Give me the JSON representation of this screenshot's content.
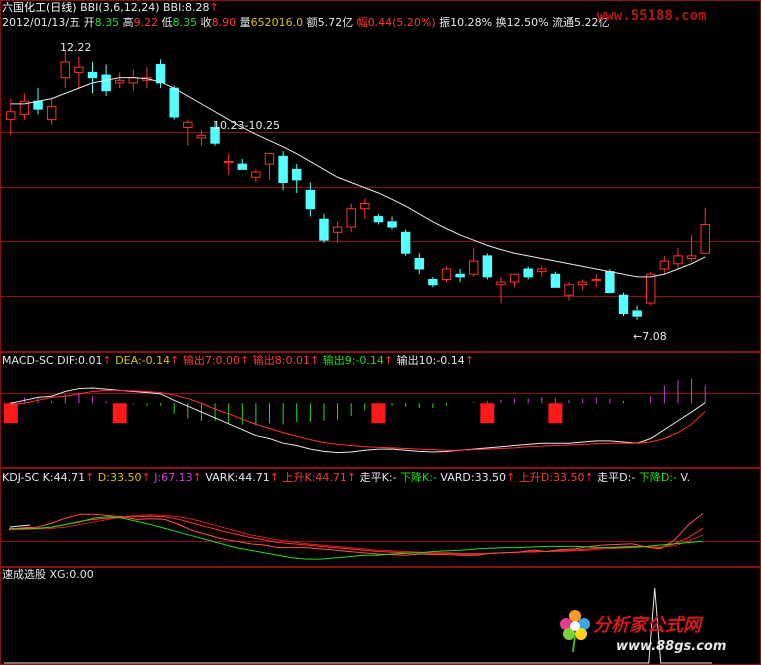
{
  "header": {
    "line1": [
      {
        "text": "六国化工(日线)",
        "color": "#ffffff"
      },
      {
        "text": " BBI(3,6,12,24) ",
        "color": "#e8e8e8"
      },
      {
        "text": "BBI:8.28",
        "color": "#e8e8e8"
      },
      {
        "text": "↑",
        "color": "#ff3030"
      }
    ],
    "line2": [
      {
        "text": "2012/01/13/五 ",
        "color": "#e8e8e8"
      },
      {
        "text": "开",
        "color": "#e8e8e8"
      },
      {
        "text": "8.35 ",
        "color": "#22dd22"
      },
      {
        "text": "高",
        "color": "#e8e8e8"
      },
      {
        "text": "9.22 ",
        "color": "#ff3838"
      },
      {
        "text": "低",
        "color": "#e8e8e8"
      },
      {
        "text": "8.35 ",
        "color": "#22dd22"
      },
      {
        "text": "收",
        "color": "#e8e8e8"
      },
      {
        "text": "8.90 ",
        "color": "#ff3838"
      },
      {
        "text": "量",
        "color": "#e8e8e8"
      },
      {
        "text": "652016.0 ",
        "color": "#e0c000"
      },
      {
        "text": "额",
        "color": "#e8e8e8"
      },
      {
        "text": "5.72亿 ",
        "color": "#e8e8e8"
      },
      {
        "text": "幅",
        "color": "#ff3838"
      },
      {
        "text": "0.44(5.20%) ",
        "color": "#ff3838"
      },
      {
        "text": "振",
        "color": "#e8e8e8"
      },
      {
        "text": "10.28% ",
        "color": "#e8e8e8"
      },
      {
        "text": "换",
        "color": "#e8e8e8"
      },
      {
        "text": "12.50% ",
        "color": "#e8e8e8"
      },
      {
        "text": "流通",
        "color": "#e8e8e8"
      },
      {
        "text": "5.22亿",
        "color": "#e8e8e8"
      }
    ]
  },
  "watermark_top": "www.55188.com",
  "watermark_bottom": {
    "title": "分析家公式网",
    "url": "www.88gs.com"
  },
  "annotations": {
    "high_label": "12.22",
    "low_label": "←7.08",
    "mid_label": "10.23-10.25"
  },
  "macd_header": [
    {
      "text": "MACD-SC ",
      "color": "#e8e8e8"
    },
    {
      "text": "DIF:0.01",
      "color": "#e8e8e8"
    },
    {
      "text": "↑",
      "color": "#ff3030"
    },
    {
      "text": "  DEA:-0.14",
      "color": "#e0c000"
    },
    {
      "text": "↑",
      "color": "#ff3030"
    },
    {
      "text": "       输出7:0.00",
      "color": "#ff3838"
    },
    {
      "text": "↑",
      "color": "#ff3030"
    },
    {
      "text": "  输出8:0.01",
      "color": "#ff3838"
    },
    {
      "text": "↑",
      "color": "#ff3030"
    },
    {
      "text": "  输出9:-0.14",
      "color": "#22dd22"
    },
    {
      "text": "↑",
      "color": "#ff3030"
    },
    {
      "text": "  输出10:-0.14",
      "color": "#e8e8e8"
    },
    {
      "text": "↑",
      "color": "#ff3030"
    }
  ],
  "kdj_header": [
    {
      "text": "KDJ-SC ",
      "color": "#e8e8e8"
    },
    {
      "text": "K:44.71",
      "color": "#e8e8e8"
    },
    {
      "text": "↑",
      "color": "#ff3030"
    },
    {
      "text": "  D:33.50",
      "color": "#e0c000"
    },
    {
      "text": "↑",
      "color": "#ff3030"
    },
    {
      "text": "  J:67.13",
      "color": "#d040e0"
    },
    {
      "text": "↑",
      "color": "#ff3030"
    },
    {
      "text": "  VARK:44.71",
      "color": "#e8e8e8"
    },
    {
      "text": "↑",
      "color": "#ff3030"
    },
    {
      "text": "  上升K:44.71",
      "color": "#ff3838"
    },
    {
      "text": "↑",
      "color": "#ff3030"
    },
    {
      "text": "  走平K:-",
      "color": "#e8e8e8"
    },
    {
      "text": "  下降K:-",
      "color": "#22dd22"
    },
    {
      "text": "  VARD:33.50",
      "color": "#e8e8e8"
    },
    {
      "text": "↑",
      "color": "#ff3030"
    },
    {
      "text": "  上升D:33.50",
      "color": "#ff3838"
    },
    {
      "text": "↑",
      "color": "#ff3030"
    },
    {
      "text": "  走平D:-",
      "color": "#e8e8e8"
    },
    {
      "text": "  下降D:-",
      "color": "#22dd22"
    },
    {
      "text": "  V.",
      "color": "#e8e8e8"
    }
  ],
  "xg_header": [
    {
      "text": "速成选股 ",
      "color": "#e8e8e8"
    },
    {
      "text": "XG:0.00",
      "color": "#e8e8e8"
    }
  ],
  "colors": {
    "up": "#ff3030",
    "down": "#54ffff",
    "bbi": "#e8e8e8",
    "grid": "#8b1010",
    "dif": "#e8e8e8",
    "dea": "#ff3030",
    "k": "#ff3030",
    "d": "#ff3030",
    "green": "#22dd22"
  },
  "chart_data": [
    {
      "type": "candlestick",
      "title": "六国化工(日线)",
      "ylim": [
        6.6,
        12.8
      ],
      "candles": [
        {
          "o": 10.9,
          "h": 11.3,
          "l": 10.6,
          "c": 11.05
        },
        {
          "o": 11.0,
          "h": 11.4,
          "l": 10.9,
          "c": 11.25
        },
        {
          "o": 11.25,
          "h": 11.5,
          "l": 11.0,
          "c": 11.1
        },
        {
          "o": 10.9,
          "h": 11.3,
          "l": 10.8,
          "c": 11.15
        },
        {
          "o": 11.7,
          "h": 12.22,
          "l": 11.5,
          "c": 12.0
        },
        {
          "o": 11.8,
          "h": 12.1,
          "l": 11.5,
          "c": 11.9
        },
        {
          "o": 11.8,
          "h": 12.0,
          "l": 11.4,
          "c": 11.7
        },
        {
          "o": 11.75,
          "h": 11.95,
          "l": 11.35,
          "c": 11.45
        },
        {
          "o": 11.6,
          "h": 11.8,
          "l": 11.5,
          "c": 11.65
        },
        {
          "o": 11.6,
          "h": 11.85,
          "l": 11.45,
          "c": 11.7
        },
        {
          "o": 11.65,
          "h": 11.9,
          "l": 11.5,
          "c": 11.7
        },
        {
          "o": 11.95,
          "h": 12.05,
          "l": 11.5,
          "c": 11.6
        },
        {
          "o": 11.5,
          "h": 11.55,
          "l": 10.9,
          "c": 10.95
        },
        {
          "o": 10.75,
          "h": 10.9,
          "l": 10.4,
          "c": 10.85
        },
        {
          "o": 10.55,
          "h": 10.7,
          "l": 10.4,
          "c": 10.6
        },
        {
          "o": 10.75,
          "h": 10.85,
          "l": 10.4,
          "c": 10.45
        },
        {
          "o": 10.1,
          "h": 10.25,
          "l": 9.85,
          "c": 10.1
        },
        {
          "o": 10.05,
          "h": 10.15,
          "l": 9.95,
          "c": 9.95
        },
        {
          "o": 9.8,
          "h": 9.95,
          "l": 9.7,
          "c": 9.9
        },
        {
          "o": 10.05,
          "h": 10.25,
          "l": 9.75,
          "c": 10.25
        },
        {
          "o": 10.2,
          "h": 10.3,
          "l": 9.55,
          "c": 9.7
        },
        {
          "o": 9.95,
          "h": 10.05,
          "l": 9.5,
          "c": 9.75
        },
        {
          "o": 9.55,
          "h": 9.7,
          "l": 9.05,
          "c": 9.2
        },
        {
          "o": 9.0,
          "h": 9.1,
          "l": 8.55,
          "c": 8.6
        },
        {
          "o": 8.75,
          "h": 8.95,
          "l": 8.55,
          "c": 8.85
        },
        {
          "o": 8.85,
          "h": 9.3,
          "l": 8.75,
          "c": 9.2
        },
        {
          "o": 9.2,
          "h": 9.4,
          "l": 9.0,
          "c": 9.3
        },
        {
          "o": 9.05,
          "h": 9.1,
          "l": 8.9,
          "c": 8.95
        },
        {
          "o": 8.95,
          "h": 9.05,
          "l": 8.8,
          "c": 8.85
        },
        {
          "o": 8.75,
          "h": 8.8,
          "l": 8.3,
          "c": 8.35
        },
        {
          "o": 8.25,
          "h": 8.35,
          "l": 7.95,
          "c": 8.05
        },
        {
          "o": 7.85,
          "h": 7.9,
          "l": 7.7,
          "c": 7.75
        },
        {
          "o": 7.85,
          "h": 8.1,
          "l": 7.8,
          "c": 8.05
        },
        {
          "o": 7.95,
          "h": 8.05,
          "l": 7.8,
          "c": 7.9
        },
        {
          "o": 7.95,
          "h": 8.45,
          "l": 7.9,
          "c": 8.2
        },
        {
          "o": 8.3,
          "h": 8.35,
          "l": 7.85,
          "c": 7.9
        },
        {
          "o": 7.75,
          "h": 7.9,
          "l": 7.4,
          "c": 7.8
        },
        {
          "o": 7.8,
          "h": 7.95,
          "l": 7.7,
          "c": 7.95
        },
        {
          "o": 8.05,
          "h": 8.1,
          "l": 7.85,
          "c": 7.9
        },
        {
          "o": 8.0,
          "h": 8.1,
          "l": 7.9,
          "c": 8.05
        },
        {
          "o": 7.95,
          "h": 8.0,
          "l": 7.7,
          "c": 7.7
        },
        {
          "o": 7.55,
          "h": 7.8,
          "l": 7.45,
          "c": 7.75
        },
        {
          "o": 7.75,
          "h": 7.85,
          "l": 7.65,
          "c": 7.8
        },
        {
          "o": 7.85,
          "h": 7.95,
          "l": 7.7,
          "c": 7.85
        },
        {
          "o": 8.0,
          "h": 8.05,
          "l": 7.6,
          "c": 7.6
        },
        {
          "o": 7.55,
          "h": 7.6,
          "l": 7.15,
          "c": 7.2
        },
        {
          "o": 7.25,
          "h": 7.35,
          "l": 7.08,
          "c": 7.15
        },
        {
          "o": 7.4,
          "h": 8.0,
          "l": 7.35,
          "c": 7.95
        },
        {
          "o": 8.05,
          "h": 8.3,
          "l": 7.95,
          "c": 8.2
        },
        {
          "o": 8.15,
          "h": 8.45,
          "l": 8.05,
          "c": 8.3
        },
        {
          "o": 8.25,
          "h": 8.7,
          "l": 8.2,
          "c": 8.3
        },
        {
          "o": 8.35,
          "h": 9.22,
          "l": 8.35,
          "c": 8.9
        }
      ],
      "bbi": [
        11.2,
        11.2,
        11.25,
        11.3,
        11.4,
        11.5,
        11.6,
        11.65,
        11.7,
        11.7,
        11.68,
        11.62,
        11.5,
        11.35,
        11.2,
        11.05,
        10.9,
        10.75,
        10.62,
        10.5,
        10.38,
        10.25,
        10.1,
        9.95,
        9.8,
        9.7,
        9.6,
        9.5,
        9.38,
        9.25,
        9.1,
        8.95,
        8.82,
        8.7,
        8.6,
        8.5,
        8.42,
        8.35,
        8.3,
        8.25,
        8.2,
        8.15,
        8.1,
        8.05,
        8.0,
        7.95,
        7.9,
        7.9,
        7.95,
        8.05,
        8.15,
        8.28
      ]
    },
    {
      "type": "line",
      "title": "MACD-SC",
      "ylim": [
        -1.0,
        0.6
      ],
      "series": [
        {
          "name": "DIF",
          "values": [
            0.0,
            0.05,
            0.1,
            0.12,
            0.2,
            0.25,
            0.26,
            0.24,
            0.22,
            0.2,
            0.18,
            0.16,
            0.05,
            -0.05,
            -0.15,
            -0.25,
            -0.35,
            -0.45,
            -0.55,
            -0.6,
            -0.68,
            -0.72,
            -0.78,
            -0.82,
            -0.84,
            -0.83,
            -0.8,
            -0.78,
            -0.78,
            -0.8,
            -0.82,
            -0.83,
            -0.82,
            -0.8,
            -0.78,
            -0.76,
            -0.74,
            -0.72,
            -0.7,
            -0.68,
            -0.68,
            -0.68,
            -0.66,
            -0.64,
            -0.64,
            -0.66,
            -0.68,
            -0.6,
            -0.45,
            -0.3,
            -0.15,
            0.01
          ]
        },
        {
          "name": "DEA",
          "values": [
            -0.02,
            0.0,
            0.05,
            0.1,
            0.12,
            0.16,
            0.2,
            0.22,
            0.22,
            0.21,
            0.2,
            0.18,
            0.14,
            0.08,
            0.0,
            -0.1,
            -0.18,
            -0.27,
            -0.36,
            -0.43,
            -0.5,
            -0.56,
            -0.62,
            -0.67,
            -0.7,
            -0.72,
            -0.74,
            -0.75,
            -0.76,
            -0.77,
            -0.78,
            -0.79,
            -0.8,
            -0.8,
            -0.79,
            -0.78,
            -0.77,
            -0.76,
            -0.74,
            -0.73,
            -0.72,
            -0.71,
            -0.7,
            -0.69,
            -0.68,
            -0.68,
            -0.68,
            -0.66,
            -0.6,
            -0.5,
            -0.36,
            -0.14
          ]
        }
      ],
      "bars": [
        0.02,
        0.1,
        0.1,
        0.04,
        0.16,
        0.18,
        0.12,
        0.04,
        0.0,
        -0.02,
        -0.04,
        -0.04,
        -0.18,
        -0.26,
        -0.3,
        -0.3,
        -0.34,
        -0.36,
        -0.38,
        -0.34,
        -0.36,
        -0.32,
        -0.32,
        -0.3,
        -0.28,
        -0.22,
        -0.12,
        -0.06,
        -0.04,
        -0.06,
        -0.08,
        -0.08,
        -0.04,
        0.0,
        0.02,
        0.04,
        0.06,
        0.08,
        0.08,
        0.1,
        0.08,
        0.06,
        0.08,
        0.1,
        0.08,
        0.04,
        0.0,
        0.12,
        0.3,
        0.4,
        0.42,
        0.3
      ],
      "signal_blocks": [
        0,
        10,
        34,
        45,
        64
      ]
    },
    {
      "type": "line",
      "title": "KDJ-SC",
      "ylim": [
        -10,
        110
      ],
      "series": [
        {
          "name": "K",
          "values": [
            42,
            43,
            44,
            46,
            50,
            55,
            58,
            60,
            62,
            62,
            63,
            62,
            58,
            52,
            46,
            40,
            35,
            30,
            26,
            22,
            20,
            18,
            16,
            14,
            12,
            10,
            8,
            7,
            6,
            6,
            5,
            5,
            4,
            4,
            5,
            6,
            7,
            8,
            8,
            9,
            10,
            12,
            14,
            15,
            16,
            15,
            14,
            20,
            30,
            44
          ]
        },
        {
          "name": "D",
          "values": [
            42,
            42,
            43,
            44,
            46,
            50,
            54,
            58,
            62,
            64,
            65,
            64,
            62,
            58,
            52,
            46,
            40,
            34,
            30,
            26,
            23,
            20,
            18,
            16,
            14,
            12,
            10,
            9,
            8,
            7,
            6,
            6,
            5,
            5,
            5,
            6,
            7,
            7,
            8,
            8,
            9,
            10,
            12,
            13,
            14,
            15,
            15,
            17,
            24,
            33.5
          ]
        },
        {
          "name": "J",
          "values": [
            42,
            45,
            46,
            52,
            60,
            66,
            66,
            64,
            62,
            58,
            59,
            58,
            50,
            40,
            34,
            28,
            24,
            20,
            18,
            14,
            14,
            14,
            12,
            10,
            8,
            6,
            4,
            3,
            2,
            4,
            3,
            3,
            2,
            2,
            5,
            6,
            7,
            10,
            8,
            11,
            12,
            16,
            18,
            19,
            20,
            15,
            12,
            26,
            50,
            67.13
          ]
        },
        {
          "name": "green",
          "values": [
            44,
            44,
            44,
            46,
            50,
            54,
            60,
            62,
            60,
            55,
            50,
            44,
            38,
            32,
            26,
            20,
            14,
            10,
            6,
            2,
            -2,
            -4,
            -4,
            -2,
            0,
            2,
            2,
            4,
            5,
            6,
            8,
            9,
            10,
            12,
            13,
            14,
            14,
            15,
            16,
            16,
            16,
            15,
            14,
            14,
            15,
            16,
            18,
            20,
            22,
            24
          ]
        }
      ]
    },
    {
      "type": "line",
      "title": "速成选股",
      "series": [
        {
          "name": "XG",
          "values": [
            0,
            0,
            0,
            0,
            0,
            0,
            0,
            0,
            0,
            0,
            0,
            0,
            0,
            0,
            0,
            0,
            0,
            0,
            0,
            0,
            0,
            0,
            0,
            0,
            0,
            0,
            0,
            0,
            0,
            0,
            0,
            0,
            0,
            0,
            0,
            0,
            0,
            0,
            0,
            0,
            0,
            0,
            0,
            0,
            0,
            0,
            0,
            0,
            0,
            0,
            0,
            0
          ]
        }
      ],
      "pulse_index": 47
    }
  ]
}
